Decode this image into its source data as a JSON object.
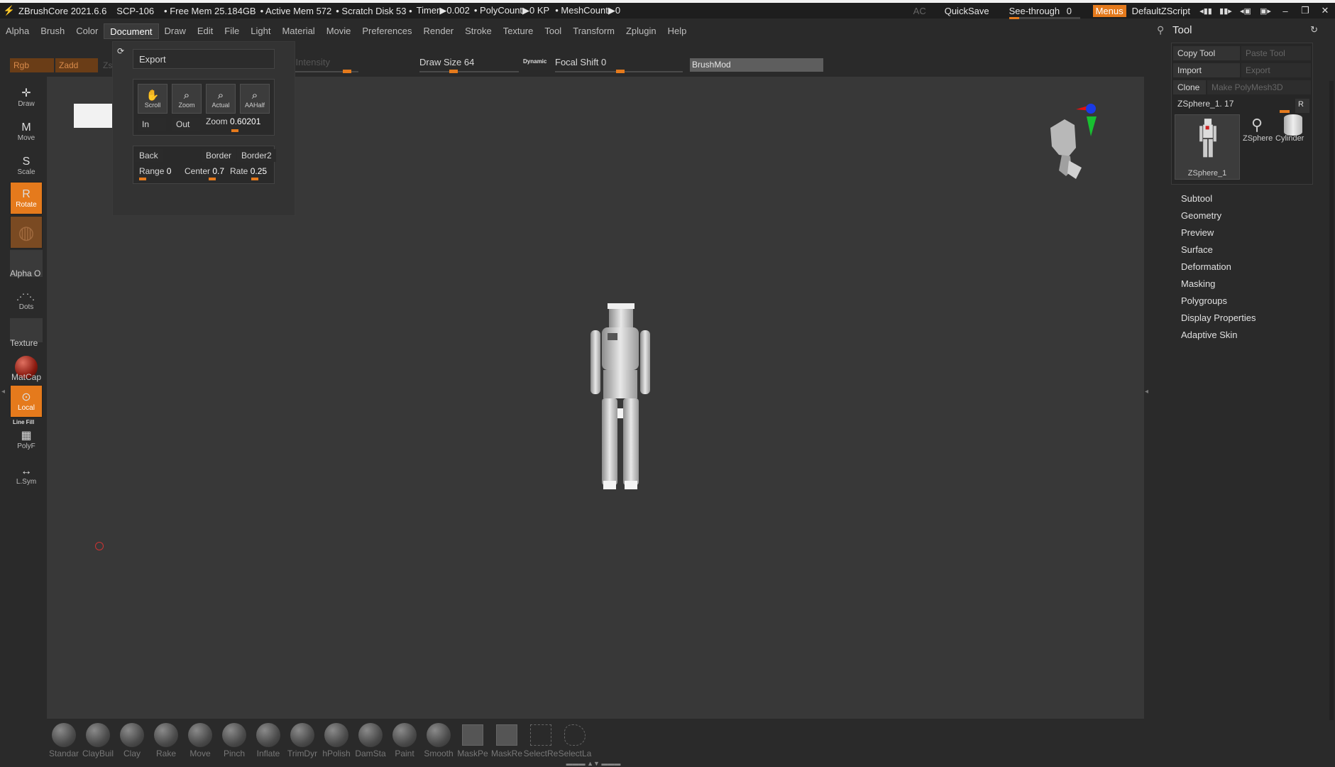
{
  "titlebar": {
    "app": "ZBrushCore 2021.6.6",
    "project": "SCP-106",
    "free_mem": "• Free Mem 25.184GB",
    "active_mem": "• Active Mem 572",
    "scratch": "• Scratch Disk 53 •",
    "timer": "Timer▶0.002",
    "polycount": "• PolyCount▶0 KP",
    "meshcount": "• MeshCount▶0",
    "ac": "AC",
    "quicksave": "QuickSave",
    "see_through_label": "See-through",
    "see_through_value": "0",
    "see_through_fraction": 0,
    "menus": "Menus",
    "default_script": "DefaultZScript"
  },
  "menubar": [
    "Alpha",
    "Brush",
    "Color",
    "Document",
    "Draw",
    "Edit",
    "File",
    "Light",
    "Material",
    "Movie",
    "Preferences",
    "Render",
    "Stroke",
    "Texture",
    "Tool",
    "Transform",
    "Zplugin",
    "Help"
  ],
  "menubar_active": "Document",
  "topshelf": {
    "rgb": "Rgb",
    "zadd": "Zadd",
    "zsub": "Zsub",
    "zintensity": "Z Intensity",
    "draw_size_label": "Draw Size",
    "draw_size_value": "64",
    "dynamic": "Dynamic",
    "focal_shift_label": "Focal Shift",
    "focal_shift_value": "0",
    "brushmod": "BrushMod"
  },
  "document_popup": {
    "export": "Export",
    "icons": [
      "Scroll",
      "Zoom",
      "Actual",
      "AAHalf"
    ],
    "in": "In",
    "out": "Out",
    "zoom_label": "Zoom",
    "zoom_value": "0.60201",
    "back": "Back",
    "border": "Border",
    "border2": "Border2",
    "range_label": "Range",
    "range_value": "0",
    "center_label": "Center",
    "center_value": "0.7",
    "rate_label": "Rate",
    "rate_value": "0.25"
  },
  "lefttoolbar": {
    "draw": "Draw",
    "move": "Move",
    "scale": "Scale",
    "rotate": "Rotate",
    "alpha": "Alpha O",
    "dots": "Dots",
    "texture": "Texture",
    "matcap": "MatCap",
    "local": "Local",
    "linefill": "Line Fill",
    "polyf": "PolyF",
    "lsym": "L.Sym"
  },
  "tool_panel": {
    "title": "Tool",
    "copy_tool": "Copy Tool",
    "paste_tool": "Paste Tool",
    "import": "Import",
    "export": "Export",
    "clone": "Clone",
    "make_polymesh": "Make PolyMesh3D",
    "zsphere_label": "ZSphere_1. 17",
    "r": "R",
    "thumb_main": "ZSphere_1",
    "thumb_zsphere": "ZSphere",
    "thumb_cylinder": "Cylinder",
    "sections": [
      "Subtool",
      "Geometry",
      "Preview",
      "Surface",
      "Deformation",
      "Masking",
      "Polygroups",
      "Display Properties",
      "Adaptive Skin"
    ]
  },
  "brushes": [
    "Standar",
    "ClayBuil",
    "Clay",
    "Rake",
    "Move",
    "Pinch",
    "Inflate",
    "TrimDyr",
    "hPolish",
    "DamSta",
    "Paint",
    "Smooth",
    "MaskPe",
    "MaskRe",
    "SelectRe",
    "SelectLa"
  ],
  "colors": {
    "accent": "#e57a1c",
    "viewport": "#383838",
    "panel": "#2a2a2a"
  }
}
